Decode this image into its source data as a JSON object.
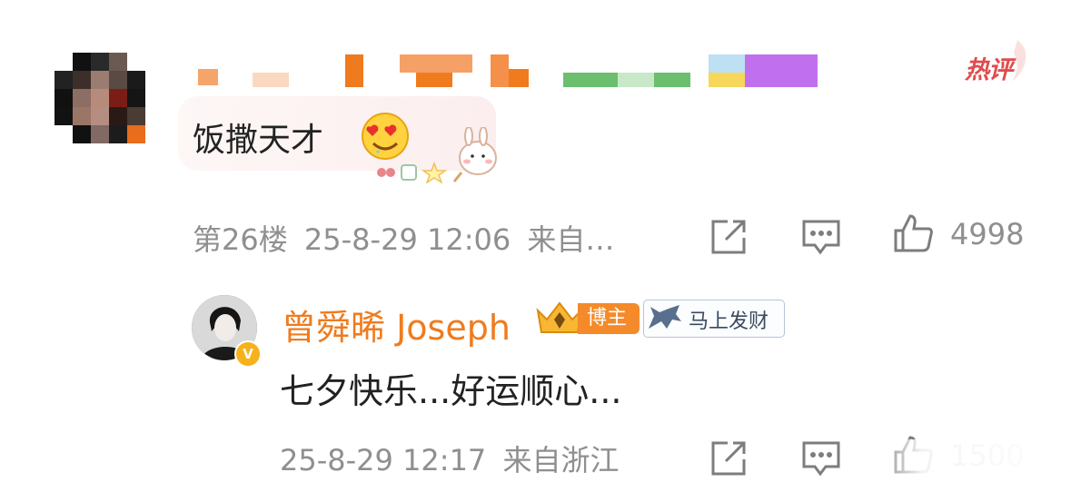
{
  "comment": {
    "author": {
      "name_pixelated": true,
      "avatar": "pixelated-avatar"
    },
    "hot_label": "热评",
    "text": "饭撒天才",
    "emoji": "heart-eyes-emoji",
    "floor": "第26楼",
    "timestamp": "25-8-29 12:06",
    "location": "来自…",
    "like_count": "4998"
  },
  "reply": {
    "author_name": "曾舜晞 Joseph",
    "author_badge": "博主",
    "medal_label": "马上发财",
    "text": "七夕快乐...好运顺心...",
    "timestamp": "25-8-29 12:17",
    "location": "来自浙江",
    "like_count": "1500"
  },
  "colors": {
    "hot": "#e24b4b",
    "author_name": "#f07b1e",
    "badge": "#f58a2a",
    "meta": "#8f8f8f"
  },
  "icons": [
    "share-icon",
    "comment-icon",
    "like-icon",
    "verified-badge-icon",
    "crown-icon",
    "horse-icon"
  ]
}
